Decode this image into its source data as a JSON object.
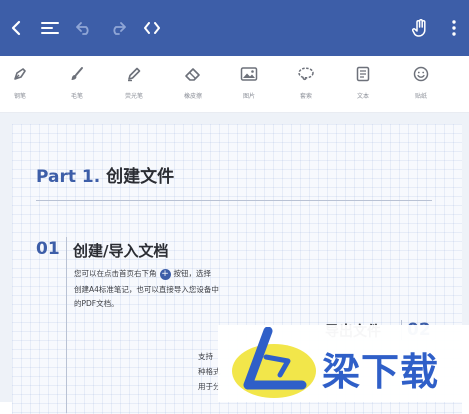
{
  "topbar": {
    "background": "#3d5ea8",
    "icons": [
      "back-chevron-icon",
      "menu-lines-icon",
      "undo-icon",
      "redo-icon",
      "code-brackets-icon",
      "hand-pointer-icon",
      "more-vertical-icon"
    ]
  },
  "toolbar": {
    "tools": [
      {
        "label": "钢笔",
        "icon": "fountain-pen-icon"
      },
      {
        "label": "毛笔",
        "icon": "brush-icon"
      },
      {
        "label": "荧光笔",
        "icon": "highlighter-icon"
      },
      {
        "label": "橡皮擦",
        "icon": "eraser-icon"
      },
      {
        "label": "图片",
        "icon": "image-icon"
      },
      {
        "label": "套索",
        "icon": "lasso-icon"
      },
      {
        "label": "文本",
        "icon": "text-box-icon"
      },
      {
        "label": "贴纸",
        "icon": "sticker-smiley-icon"
      }
    ]
  },
  "document": {
    "part_lead": "Part 1.",
    "part_rest": "创建文件",
    "section1": {
      "number": "01",
      "title": "创建/导入文档",
      "line1_before": "您可以在点击首页右下角",
      "plus_symbol": "+",
      "line1_after": "按钮，选择",
      "line2": "创建A4标准笔记，也可以直接导入您设备中",
      "line3": "的PDF文档。"
    },
    "section2": {
      "title": "导出文件",
      "number": "02",
      "line1": "支持",
      "line2": "种格式",
      "line3": "用于分"
    }
  },
  "watermark": {
    "text": "梁下载",
    "colors": {
      "yellow": "#f2e64a",
      "blue": "#2f5fc8"
    }
  }
}
